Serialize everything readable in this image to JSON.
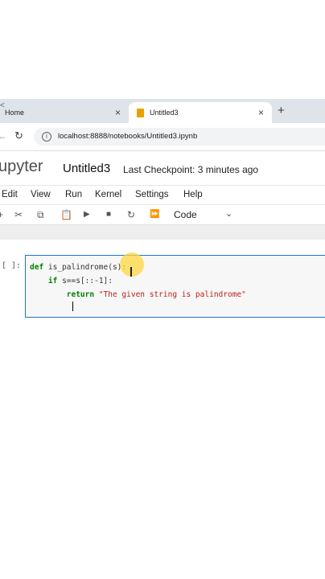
{
  "browser": {
    "tabs": [
      {
        "label": "Home",
        "close": "×"
      },
      {
        "label": "Untitled3",
        "close": "×"
      }
    ],
    "new_tab": "+",
    "url": "localhost:8888/notebooks/Untitled3.ipynb"
  },
  "jupyter": {
    "logo_text": "upyter",
    "notebook_title": "Untitled3",
    "checkpoint": "Last Checkpoint: 3 minutes ago"
  },
  "menu": [
    "Edit",
    "View",
    "Run",
    "Kernel",
    "Settings",
    "Help"
  ],
  "toolbar": {
    "icons": [
      "cut-icon",
      "copy-icon",
      "paste-icon",
      "run-icon",
      "stop-icon",
      "restart-icon",
      "fast-forward-icon"
    ],
    "cell_type": "Code"
  },
  "cell": {
    "prompt": "[ ]:",
    "code": {
      "line1_kw": "def",
      "line1_rest": " is_palindrome(s):",
      "line2_kw": "if",
      "line2_rest": " s==s[::-1]:",
      "line3_kw": "return",
      "line3_str": "\"The given string is palindrome\""
    }
  }
}
